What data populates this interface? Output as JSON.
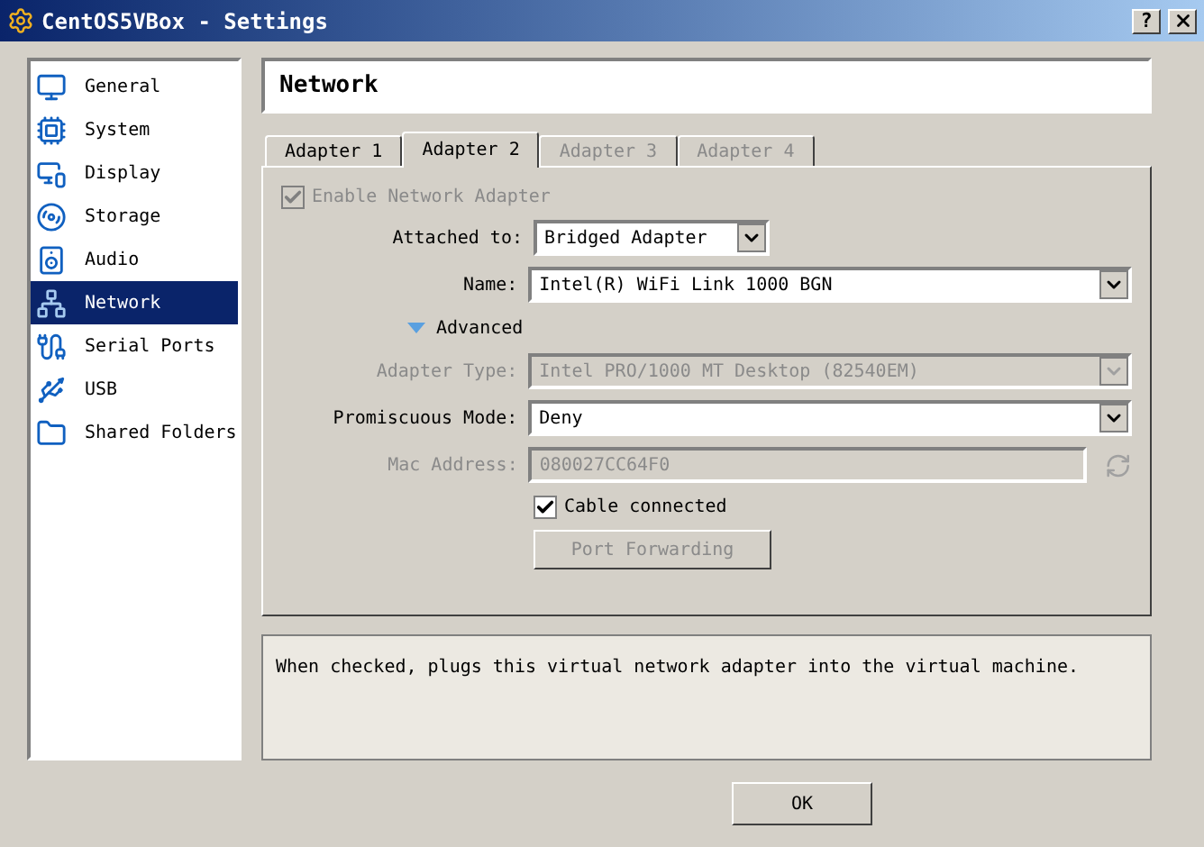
{
  "window": {
    "title": "CentOS5VBox - Settings",
    "help_button": "?"
  },
  "sidebar": {
    "items": [
      {
        "label": "General",
        "kind": "general",
        "selected": false
      },
      {
        "label": "System",
        "kind": "system",
        "selected": false
      },
      {
        "label": "Display",
        "kind": "display",
        "selected": false
      },
      {
        "label": "Storage",
        "kind": "storage",
        "selected": false
      },
      {
        "label": "Audio",
        "kind": "audio",
        "selected": false
      },
      {
        "label": "Network",
        "kind": "network",
        "selected": true
      },
      {
        "label": "Serial Ports",
        "kind": "serial",
        "selected": false
      },
      {
        "label": "USB",
        "kind": "usb",
        "selected": false
      },
      {
        "label": "Shared Folders",
        "kind": "folder",
        "selected": false
      }
    ]
  },
  "page_title": "Network",
  "tabs": [
    {
      "label": "Adapter 1",
      "selected": false,
      "disabled": false
    },
    {
      "label": "Adapter 2",
      "selected": true,
      "disabled": false
    },
    {
      "label": "Adapter 3",
      "selected": false,
      "disabled": true
    },
    {
      "label": "Adapter 4",
      "selected": false,
      "disabled": true
    }
  ],
  "enable_adapter": {
    "label": "Enable Network Adapter",
    "checked": true,
    "disabled": true
  },
  "attached_to": {
    "label": "Attached to:",
    "value": "Bridged Adapter",
    "disabled": false
  },
  "name": {
    "label": "Name:",
    "value": "Intel(R) WiFi Link 1000 BGN",
    "disabled": false
  },
  "advanced": {
    "label": "Advanced",
    "expanded": true
  },
  "adapter_type": {
    "label": "Adapter Type:",
    "value": "Intel PRO/1000 MT Desktop (82540EM)",
    "disabled": true
  },
  "promiscuous_mode": {
    "label": "Promiscuous Mode:",
    "value": "Deny",
    "disabled": false
  },
  "mac_address": {
    "label": "Mac Address:",
    "value": "080027CC64F0",
    "disabled": true
  },
  "cable_connected": {
    "label": "Cable connected",
    "checked": true,
    "disabled": false
  },
  "port_forwarding": {
    "label": "Port Forwarding",
    "disabled": true
  },
  "description": "When checked, plugs this virtual network adapter into the virtual machine.",
  "ok_button": "OK"
}
